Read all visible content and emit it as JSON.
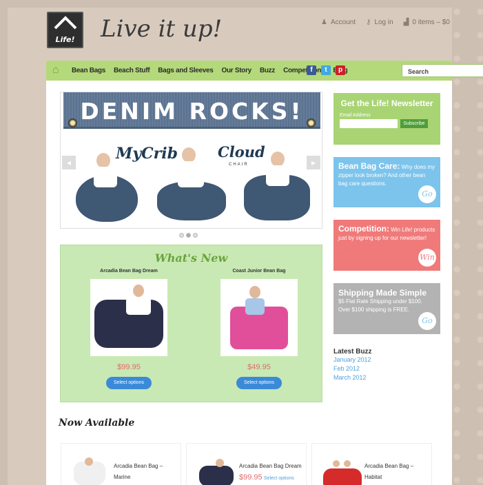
{
  "brand": {
    "logo_text": "Life!",
    "tagline": "Live it up!"
  },
  "topbar": {
    "account": "Account",
    "login": "Log in",
    "cart": "0 items – $0"
  },
  "nav": {
    "items": [
      "Bean Bags",
      "Beach Stuff",
      "Bags and Sleeves",
      "Our Story",
      "Buzz",
      "Competitions",
      "Blog"
    ],
    "search_placeholder": "Search"
  },
  "slider": {
    "banner": "DENIM ROCKS!",
    "label_left": "MyCrib",
    "label_right": "Cloud",
    "label_right_sub": "CHAIR"
  },
  "whats_new": {
    "title": "What's New",
    "products": [
      {
        "name": "Arcadia Bean Bag Dream",
        "price": "$99.95",
        "button": "Select options"
      },
      {
        "name": "Coast Junior Bean Bag",
        "price": "$49.95",
        "button": "Select options"
      }
    ]
  },
  "sidebar": {
    "newsletter": {
      "title": "Get the Life! Newsletter",
      "email_label": "Email Address",
      "subscribe": "Subscribe",
      "color": "#a9d474"
    },
    "care": {
      "title": "Bean Bag Care:",
      "text": "Why does my zipper look broken? And other bean bag care questions.",
      "go": "Go",
      "color": "#7cc4ec"
    },
    "competition": {
      "title": "Competition:",
      "text": "Win Life! products just by signing up for our newsletter!",
      "go": "Win",
      "color": "#f07a7a"
    },
    "shipping": {
      "title": "Shipping Made Simple",
      "text": "$5 Flat Rate Shipping under $100. Over $100 shipping is FREE.",
      "go": "Go",
      "color": "#b3b3b3"
    },
    "buzz": {
      "title": "Latest Buzz",
      "links": [
        "January 2012",
        "Feb 2012",
        "March 2012"
      ]
    }
  },
  "now_available": {
    "title": "Now Available",
    "items": [
      {
        "name_line1": "Arcadia Bean Bag –",
        "name_line2": "Marine"
      },
      {
        "name": "Arcadia Bean Bag Dream",
        "price": "$99.95",
        "button": "Select options"
      },
      {
        "name_line1": "Arcadia Bean Bag –",
        "name_line2": "Habitat"
      }
    ]
  }
}
